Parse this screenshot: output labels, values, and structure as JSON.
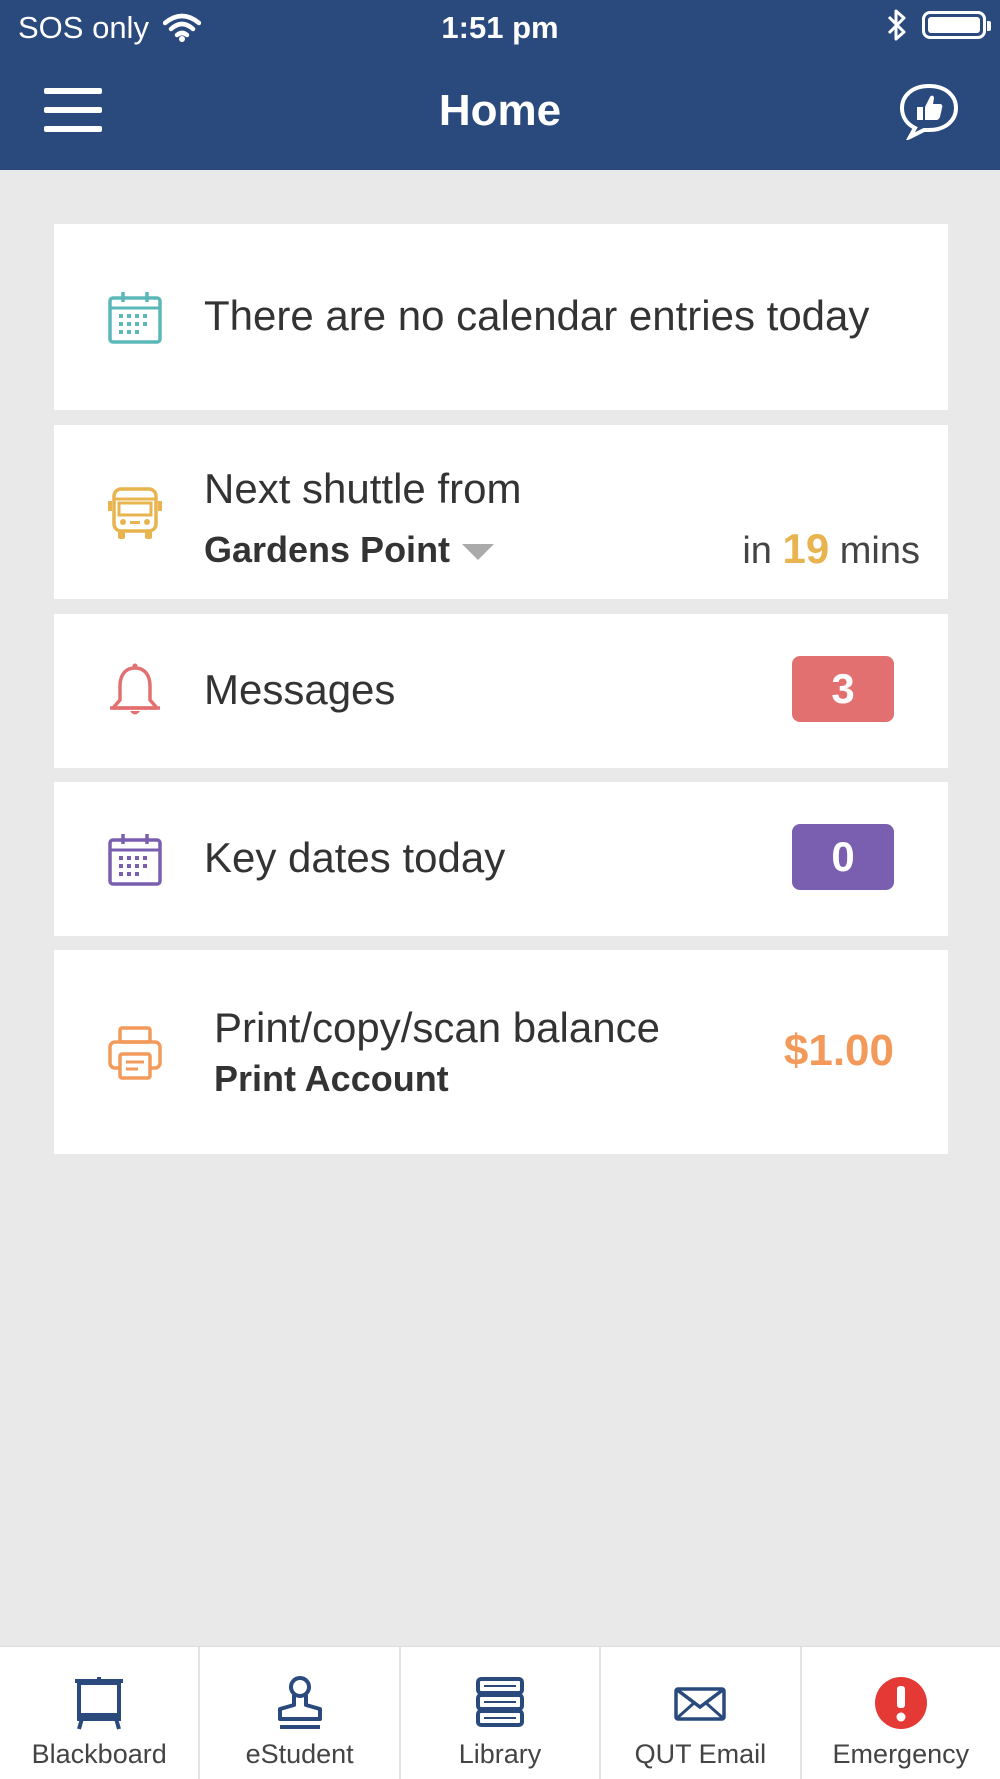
{
  "status_bar": {
    "carrier": "SOS only",
    "time": "1:51 pm"
  },
  "header": {
    "title": "Home"
  },
  "cards": {
    "calendar": {
      "text": "There are no calendar entries today",
      "icon": "calendar-icon"
    },
    "shuttle": {
      "title": "Next shuttle from",
      "location": "Gardens Point",
      "prefix": "in",
      "minutes": "19",
      "suffix": "mins",
      "icon": "bus-icon"
    },
    "messages": {
      "label": "Messages",
      "count": "3",
      "badge_color": "#e37070",
      "icon": "bell-icon"
    },
    "key_dates": {
      "label": "Key dates today",
      "count": "0",
      "badge_color": "#7a5fb0",
      "icon": "calendar-icon"
    },
    "print": {
      "label": "Print/copy/scan balance",
      "account": "Print Account",
      "balance": "$1.00",
      "accent": "#f39a5b",
      "icon": "printer-icon"
    }
  },
  "tabs": [
    {
      "label": "Blackboard",
      "icon": "blackboard-icon"
    },
    {
      "label": "eStudent",
      "icon": "student-stamp-icon"
    },
    {
      "label": "Library",
      "icon": "books-icon"
    },
    {
      "label": "QUT Email",
      "icon": "envelope-icon"
    },
    {
      "label": "Emergency",
      "icon": "alert-icon"
    }
  ],
  "colors": {
    "header_bg": "#2a4a7e",
    "shuttle_accent": "#e8b44f",
    "nav_icon": "#2a4a7e",
    "emergency": "#e53935"
  }
}
